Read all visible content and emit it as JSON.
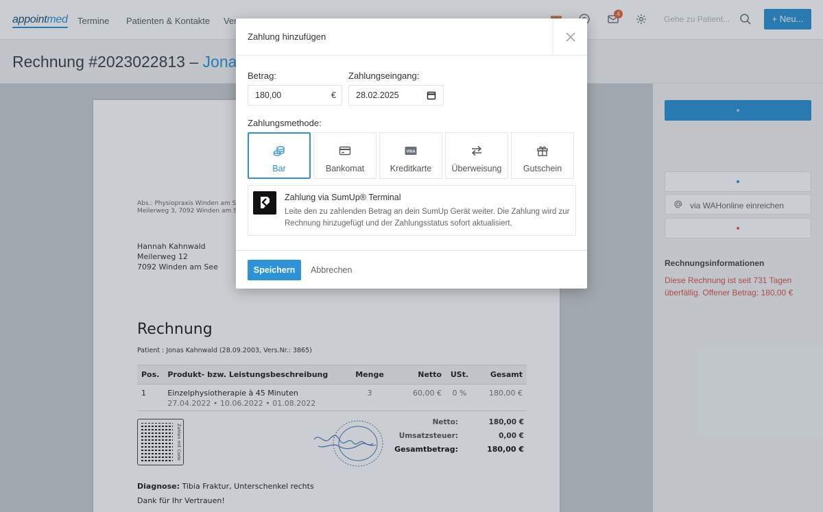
{
  "app": {
    "logo_part1": "appoint",
    "logo_part2": "med",
    "nav": [
      "Termine",
      "Patienten & Kontakte",
      "Ver"
    ],
    "notification_count": "4",
    "patient_search_placeholder": "Gehe zu Patient...",
    "new_button": "+ Neu...",
    "icons": [
      "gift-icon",
      "help-icon",
      "mail-icon",
      "gear-icon",
      "search-icon"
    ]
  },
  "page": {
    "title_prefix": "Rechnung #2023022813 – ",
    "title_name": "Jonas K"
  },
  "document": {
    "sender_line1": "Abs.: Physiopraxis Winden am See",
    "sender_line2": "Meilerweg 3, 7092 Winden am See",
    "recipient": [
      "Hannah Kahnwald",
      "Meilerweg 12",
      "7092 Winden am See"
    ],
    "heading": "Rechnung",
    "patient_line": "Patient : Jonas Kahnwald (28.09.2003, Vers.Nr.: 3865)",
    "columns": [
      "Pos.",
      "Produkt- bzw. Leistungsbeschreibung",
      "Menge",
      "Netto",
      "USt.",
      "Gesamt"
    ],
    "rows": [
      {
        "pos": "1",
        "description": "Einzelphysiotherapie à 45 Minuten",
        "dates": "27.04.2022 • 10.06.2022 • 01.08.2022",
        "quantity": "3",
        "net": "60,00 €",
        "vat": "0 %",
        "total": "180,00 €"
      }
    ],
    "qr_caption": "Zahlen mit Code",
    "totals": [
      {
        "label": "Netto:",
        "value": "180,00 €"
      },
      {
        "label": "Umsatzsteuer:",
        "value": "0,00 €"
      },
      {
        "label": "Gesamtbetrag:",
        "value": "180,00 €"
      }
    ],
    "diagnosis_label": "Diagnose:",
    "diagnosis": "Tibia Fraktur, Unterschenkel rechts",
    "thanks": "Dank für Ihr Vertrauen!"
  },
  "side": {
    "wahonline": "via WAHonline einreichen",
    "info_title": "Rechnungsinformationen",
    "info_text": "Diese Rechnung ist seit 731 Tagen überfällig. Offener Betrag: 180,00 €"
  },
  "modal": {
    "title": "Zahlung hinzufügen",
    "amount_label": "Betrag:",
    "amount_value": "180,00",
    "currency": "€",
    "date_label": "Zahlungseingang:",
    "date_value": "28.02.2025",
    "method_label": "Zahlungsmethode:",
    "methods": [
      {
        "label": "Bar",
        "icon": "coins-icon",
        "selected": true
      },
      {
        "label": "Bankomat",
        "icon": "bank-card-icon",
        "selected": false
      },
      {
        "label": "Kreditkarte",
        "icon": "credit-card-icon",
        "selected": false
      },
      {
        "label": "Überweisung",
        "icon": "transfer-icon",
        "selected": false
      },
      {
        "label": "Gutschein",
        "icon": "gift-icon",
        "selected": false
      }
    ],
    "sumup_title": "Zahlung via SumUp® Terminal",
    "sumup_desc": "Leite den zu zahlenden Betrag an dein SumUp Gerät weiter. Die Zahlung wird zur Rechnung hinzugefügt und der Zahlungsstatus sofort aktualisiert.",
    "save_label": "Speichern",
    "cancel_label": "Abbrechen"
  },
  "colors": {
    "accent": "#2d92d6",
    "danger": "#d9534f",
    "badge": "#e46a3a"
  }
}
